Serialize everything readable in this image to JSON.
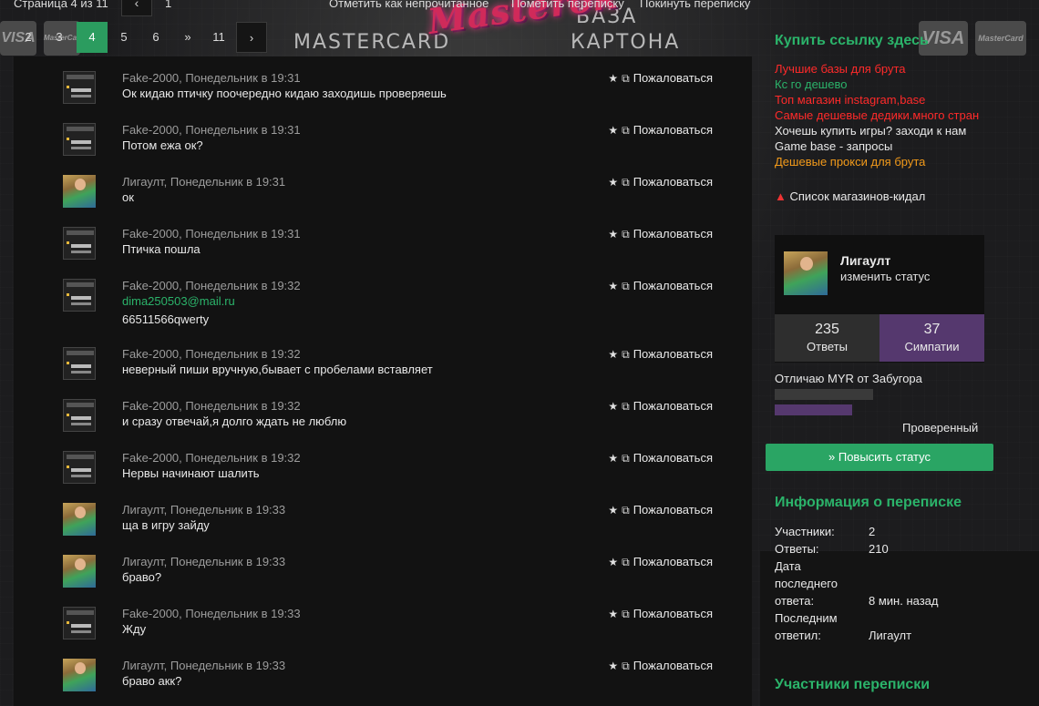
{
  "topbar": {
    "page_label": "Страница 4 из 11",
    "first_page": "1",
    "mark_unread": "Отметить как непрочитанное",
    "tag_conversation": "Пометить переписку",
    "leave_conversation": "Покинуть переписку"
  },
  "pagination": {
    "pages": [
      "2",
      "3",
      "4",
      "5",
      "6",
      "»",
      "11"
    ],
    "current": "4",
    "next_icon": "›",
    "prev_icon": "‹"
  },
  "banner": {
    "logo_text": "Masterok",
    "left_word": "MASTERCARD",
    "right_word_1": "БАЗА",
    "right_word_2": "КАРТОНА",
    "card_visa": "VISA",
    "card_mc": "MasterCard"
  },
  "messages": [
    {
      "author": "Fake-2000",
      "time": "Понедельник в 19:31",
      "lines": [
        "Ок кидаю птичку поочередно кидаю заходишь проверяешь"
      ],
      "avatar": "screen"
    },
    {
      "author": "Fake-2000",
      "time": "Понедельник в 19:31",
      "lines": [
        "Потом ежа ок?"
      ],
      "avatar": "screen"
    },
    {
      "author": "Лигаулт",
      "time": "Понедельник в 19:31",
      "lines": [
        "ок"
      ],
      "avatar": "kid"
    },
    {
      "author": "Fake-2000",
      "time": "Понедельник в 19:31",
      "lines": [
        "Птичка пошла"
      ],
      "avatar": "screen"
    },
    {
      "author": "Fake-2000",
      "time": "Понедельник в 19:32",
      "lines": [
        "dima250503@mail.ru",
        "66511566qwerty"
      ],
      "avatar": "screen"
    },
    {
      "author": "Fake-2000",
      "time": "Понедельник в 19:32",
      "lines": [
        "неверный пиши вручную,бывает с пробелами вставляет"
      ],
      "avatar": "screen"
    },
    {
      "author": "Fake-2000",
      "time": "Понедельник в 19:32",
      "lines": [
        "и сразу отвечай,я долго ждать не люблю"
      ],
      "avatar": "screen"
    },
    {
      "author": "Fake-2000",
      "time": "Понедельник в 19:32",
      "lines": [
        "Нервы начинают шалить"
      ],
      "avatar": "screen"
    },
    {
      "author": "Лигаулт",
      "time": "Понедельник в 19:33",
      "lines": [
        "ща в игру зайду"
      ],
      "avatar": "kid"
    },
    {
      "author": "Лигаулт",
      "time": "Понедельник в 19:33",
      "lines": [
        "браво?"
      ],
      "avatar": "kid"
    },
    {
      "author": "Fake-2000",
      "time": "Понедельник в 19:33",
      "lines": [
        "Жду"
      ],
      "avatar": "screen"
    },
    {
      "author": "Лигаулт",
      "time": "Понедельник в 19:33",
      "lines": [
        "браво акк?"
      ],
      "avatar": "kid"
    }
  ],
  "report_label": "Пожаловаться",
  "sidebar": {
    "buy_link_title": "Купить ссылку здесь",
    "ads": [
      {
        "text": "Лучшие базы для брута",
        "color": "#ff2a2a"
      },
      {
        "text": "Кс го дешево",
        "color": "#2bb36a"
      },
      {
        "text": "Топ магазин instagram,base",
        "color": "#ff2a2a"
      },
      {
        "text": "Самые дешевые дедики.много стран",
        "color": "#ff2a2a"
      },
      {
        "text": "Хочешь купить игры? заходи к нам",
        "color": "#e8e8e8"
      },
      {
        "text": "Game base - запросы",
        "color": "#e8e8e8"
      },
      {
        "text": "Дешевые прокси для брута",
        "color": "#f29a1a"
      }
    ],
    "scam_list": "Список магазинов-кидал",
    "profile": {
      "name": "Лигаулт",
      "status_link": "изменить статус",
      "replies_count": "235",
      "replies_label": "Ответы",
      "likes_count": "37",
      "likes_label": "Симпатии",
      "rank_title": "Отличаю MYR от Забугора",
      "rank_progress": 0.5,
      "rank_label": "Проверенный",
      "upgrade_label": "Повысить статус"
    },
    "info_title": "Информация о переписке",
    "info": {
      "participants_label": "Участники:",
      "participants_value": "2",
      "replies_label": "Ответы:",
      "replies_value": "210",
      "last_reply_date_label_1": "Дата",
      "last_reply_date_label_2": "последнего",
      "last_reply_date_label_3": "ответа:",
      "last_reply_date_value": "8 мин. назад",
      "last_replier_label_1": "Последним",
      "last_replier_label_2": "ответил:",
      "last_replier_value": "Лигаулт"
    },
    "participants_title": "Участники переписки"
  },
  "colors": {
    "accent_green": "#2bb36a",
    "button_green": "#2aa564",
    "likes_purple": "#55386e",
    "replies_gray": "#2e2e2e"
  }
}
